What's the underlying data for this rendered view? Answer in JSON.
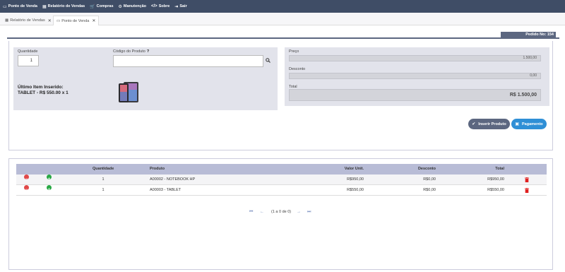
{
  "menu": {
    "items": [
      {
        "icon": "monitor-icon",
        "glyph": "▭",
        "label": "Ponto de Venda"
      },
      {
        "icon": "table-icon",
        "glyph": "▦",
        "label": "Relatório de Vendas"
      },
      {
        "icon": "cart-icon",
        "glyph": "🛒",
        "label": "Compras"
      },
      {
        "icon": "gear-icon",
        "glyph": "⚙",
        "label": "Manutenção"
      },
      {
        "icon": "code-icon",
        "glyph": "</>",
        "label": "Sobre"
      },
      {
        "icon": "exit-icon",
        "glyph": "⇥",
        "label": "Sair"
      }
    ]
  },
  "tabs": [
    {
      "label": "Relatório de Vendas",
      "icon": "table-icon",
      "close": "✕"
    },
    {
      "label": "Ponto de Venda",
      "icon": "monitor-icon",
      "close": "✕"
    }
  ],
  "order": {
    "label": "Pedido No: 154"
  },
  "entry": {
    "quantity_label": "Quantidade",
    "quantity_value": "1",
    "code_label": "Código do Produto",
    "code_value": "",
    "last_item_title": "Último Item Inserido:",
    "last_item_text": "TABLET - R$ 550.00 x 1"
  },
  "summary": {
    "price_label": "Preço",
    "price_value": "1.500,00",
    "discount_label": "Desconto",
    "discount_value": "0,00",
    "total_label": "Total",
    "total_value": "R$ 1.500,00"
  },
  "actions": {
    "insert_label": "Inserir Produto",
    "payment_label": "Pagamento"
  },
  "table": {
    "headers": {
      "quantity": "Quantidade",
      "product": "Produto",
      "unit": "Valor Unit.",
      "discount": "Desconto",
      "total": "Total"
    },
    "rows": [
      {
        "quantity": "1",
        "product": "A00002 - NOTEBOOK HP",
        "unit": "R$950,00",
        "discount": "R$0,00",
        "total": "R$950,00"
      },
      {
        "quantity": "1",
        "product": "A00003 - TABLET",
        "unit": "R$550,00",
        "discount": "R$0,00",
        "total": "R$550,00"
      }
    ]
  },
  "pager": {
    "text": "(1 a 0 de 0)"
  },
  "colors": {
    "menubar": "#3f4d66",
    "accent": "#5c6780",
    "primary": "#2f8fd6",
    "danger": "#e04848",
    "success": "#29a845"
  }
}
